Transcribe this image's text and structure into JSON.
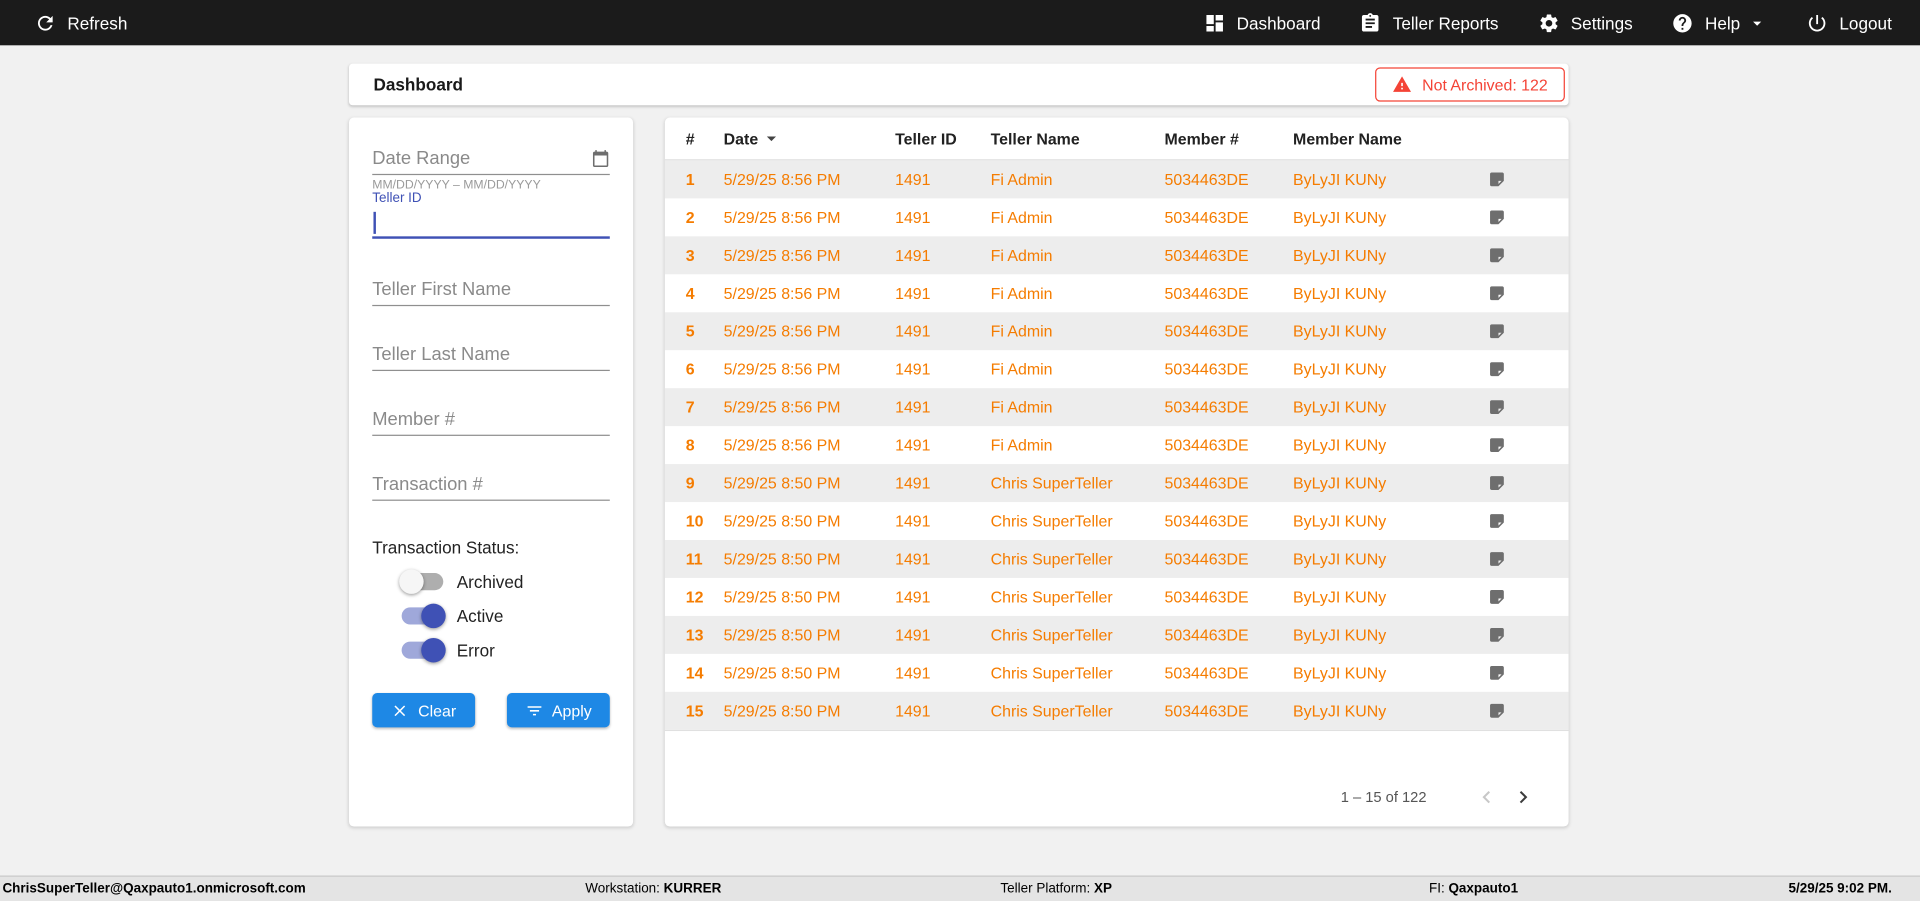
{
  "topbar": {
    "refresh_label": "Refresh",
    "nav": [
      {
        "label": "Dashboard"
      },
      {
        "label": "Teller Reports"
      },
      {
        "label": "Settings"
      },
      {
        "label": "Help"
      },
      {
        "label": "Logout"
      }
    ]
  },
  "header": {
    "title": "Dashboard",
    "not_archived_label": "Not Archived: 122"
  },
  "filters": {
    "date_range_placeholder": "Date Range",
    "date_range_hint": "MM/DD/YYYY – MM/DD/YYYY",
    "teller_id_label": "Teller ID",
    "teller_id_value": "",
    "teller_first_name_placeholder": "Teller First Name",
    "teller_last_name_placeholder": "Teller Last Name",
    "member_number_placeholder": "Member #",
    "transaction_number_placeholder": "Transaction #",
    "status_label": "Transaction Status:",
    "toggles": [
      {
        "label": "Archived",
        "on": false
      },
      {
        "label": "Active",
        "on": true
      },
      {
        "label": "Error",
        "on": true
      }
    ],
    "clear_label": "Clear",
    "apply_label": "Apply"
  },
  "table": {
    "columns": {
      "num": "#",
      "date": "Date",
      "teller_id": "Teller ID",
      "teller_name": "Teller Name",
      "member_number": "Member #",
      "member_name": "Member Name"
    },
    "sorted_column": "Date",
    "rows": [
      {
        "num": "1",
        "date": "5/29/25 8:56 PM",
        "teller_id": "1491",
        "teller_name": "Fi Admin",
        "member_number": "5034463DE",
        "member_name": "ByLyJI KUNy"
      },
      {
        "num": "2",
        "date": "5/29/25 8:56 PM",
        "teller_id": "1491",
        "teller_name": "Fi Admin",
        "member_number": "5034463DE",
        "member_name": "ByLyJI KUNy"
      },
      {
        "num": "3",
        "date": "5/29/25 8:56 PM",
        "teller_id": "1491",
        "teller_name": "Fi Admin",
        "member_number": "5034463DE",
        "member_name": "ByLyJI KUNy"
      },
      {
        "num": "4",
        "date": "5/29/25 8:56 PM",
        "teller_id": "1491",
        "teller_name": "Fi Admin",
        "member_number": "5034463DE",
        "member_name": "ByLyJI KUNy"
      },
      {
        "num": "5",
        "date": "5/29/25 8:56 PM",
        "teller_id": "1491",
        "teller_name": "Fi Admin",
        "member_number": "5034463DE",
        "member_name": "ByLyJI KUNy"
      },
      {
        "num": "6",
        "date": "5/29/25 8:56 PM",
        "teller_id": "1491",
        "teller_name": "Fi Admin",
        "member_number": "5034463DE",
        "member_name": "ByLyJI KUNy"
      },
      {
        "num": "7",
        "date": "5/29/25 8:56 PM",
        "teller_id": "1491",
        "teller_name": "Fi Admin",
        "member_number": "5034463DE",
        "member_name": "ByLyJI KUNy"
      },
      {
        "num": "8",
        "date": "5/29/25 8:56 PM",
        "teller_id": "1491",
        "teller_name": "Fi Admin",
        "member_number": "5034463DE",
        "member_name": "ByLyJI KUNy"
      },
      {
        "num": "9",
        "date": "5/29/25 8:50 PM",
        "teller_id": "1491",
        "teller_name": "Chris SuperTeller",
        "member_number": "5034463DE",
        "member_name": "ByLyJI KUNy"
      },
      {
        "num": "10",
        "date": "5/29/25 8:50 PM",
        "teller_id": "1491",
        "teller_name": "Chris SuperTeller",
        "member_number": "5034463DE",
        "member_name": "ByLyJI KUNy"
      },
      {
        "num": "11",
        "date": "5/29/25 8:50 PM",
        "teller_id": "1491",
        "teller_name": "Chris SuperTeller",
        "member_number": "5034463DE",
        "member_name": "ByLyJI KUNy"
      },
      {
        "num": "12",
        "date": "5/29/25 8:50 PM",
        "teller_id": "1491",
        "teller_name": "Chris SuperTeller",
        "member_number": "5034463DE",
        "member_name": "ByLyJI KUNy"
      },
      {
        "num": "13",
        "date": "5/29/25 8:50 PM",
        "teller_id": "1491",
        "teller_name": "Chris SuperTeller",
        "member_number": "5034463DE",
        "member_name": "ByLyJI KUNy"
      },
      {
        "num": "14",
        "date": "5/29/25 8:50 PM",
        "teller_id": "1491",
        "teller_name": "Chris SuperTeller",
        "member_number": "5034463DE",
        "member_name": "ByLyJI KUNy"
      },
      {
        "num": "15",
        "date": "5/29/25 8:50 PM",
        "teller_id": "1491",
        "teller_name": "Chris SuperTeller",
        "member_number": "5034463DE",
        "member_name": "ByLyJI KUNy"
      }
    ],
    "pagination_label": "1 – 15 of 122"
  },
  "footer": {
    "user": "ChrisSuperTeller@Qaxpauto1.onmicrosoft.com",
    "workstation_label": "Workstation:",
    "workstation_value": "KURRER",
    "platform_label": "Teller Platform:",
    "platform_value": "XP",
    "fi_label": "FI:",
    "fi_value": "Qaxpauto1",
    "datetime": "5/29/25 9:02 PM."
  },
  "colors": {
    "topbar_bg": "#1B1B1B",
    "accent_orange": "#F57C00",
    "button_blue": "#1E88E5",
    "toggle_blue": "#3F51B5",
    "alert_red": "#F44336"
  }
}
